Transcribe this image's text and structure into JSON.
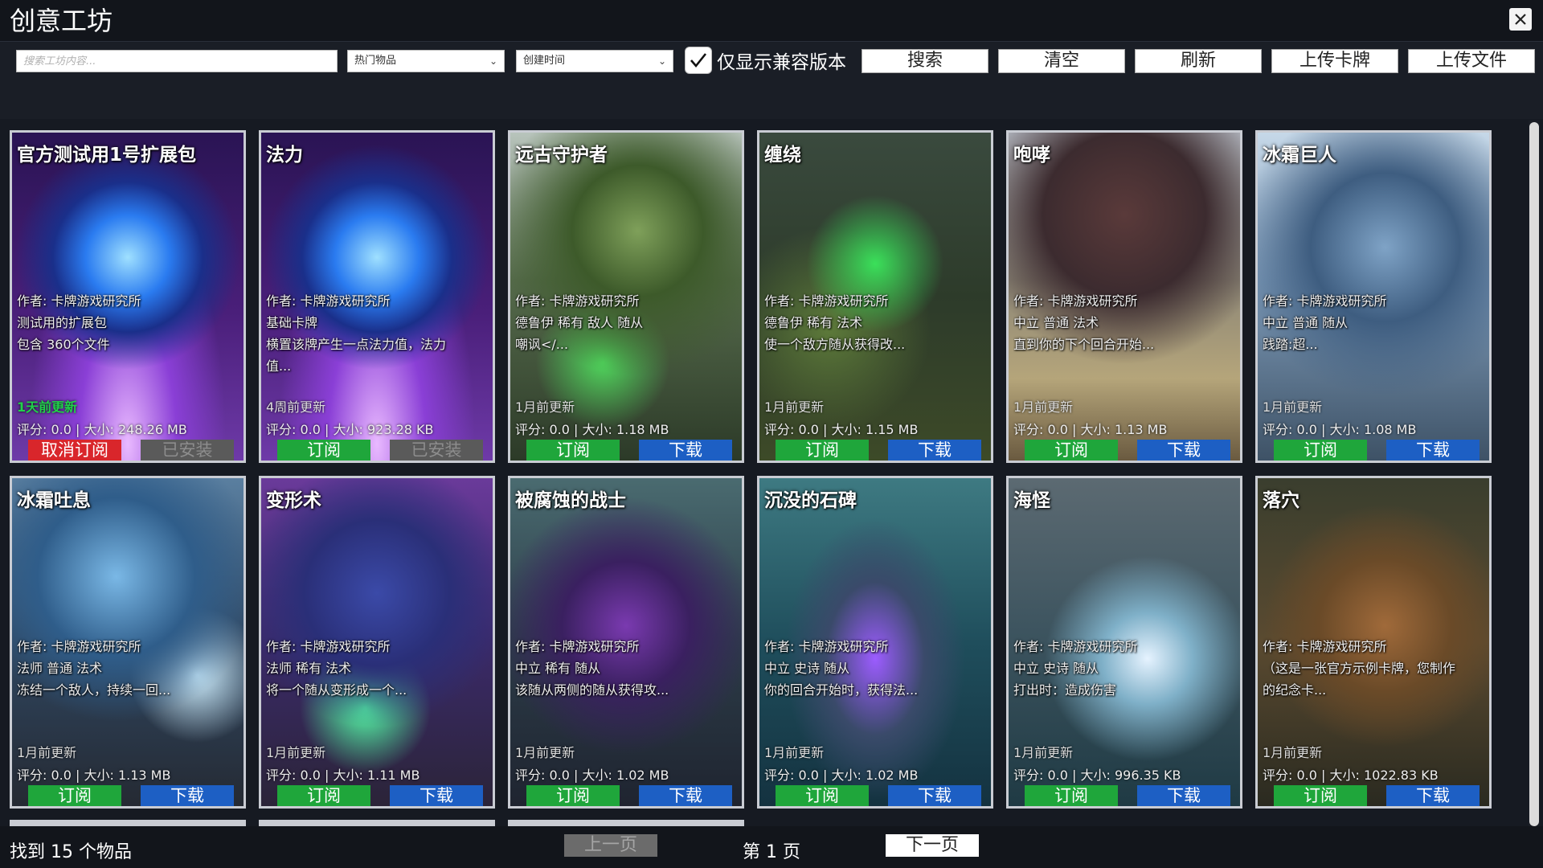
{
  "app": {
    "title": "创意工坊"
  },
  "toolbar": {
    "search_placeholder": "搜索工坊内容...",
    "sort_filter": "热门物品",
    "time_filter": "创建时间",
    "compat_label": "仅显示兼容版本",
    "compat_checked": true,
    "search_label": "搜索",
    "clear_label": "清空",
    "refresh_label": "刷新",
    "upload_card_label": "上传卡牌",
    "upload_file_label": "上传文件"
  },
  "cards": [
    {
      "title": "官方测试用1号扩展包",
      "author": "作者: 卡牌游戏研究所",
      "line2": "测试用的扩展包",
      "line3": "包含 360个文件",
      "line4": "",
      "updated": "1天前更新",
      "fresh": true,
      "stats": "评分: 0.0 | 大小: 248.26 MB",
      "btn1": "取消订阅",
      "btn1_style": "red",
      "btn2": "已安装",
      "btn2_style": "grey",
      "theme": "orb"
    },
    {
      "title": "法力",
      "author": "作者: 卡牌游戏研究所",
      "line2": "基础卡牌",
      "line3": "横置该牌产生一点法力值，法力",
      "line4": "值...",
      "updated": "4周前更新",
      "fresh": false,
      "stats": "评分: 0.0 | 大小: 923.28 KB",
      "btn1": "订阅",
      "btn1_style": "green",
      "btn2": "已安装",
      "btn2_style": "grey",
      "theme": "orb"
    },
    {
      "title": "远古守护者",
      "author": "作者: 卡牌游戏研究所",
      "line2": "德鲁伊 稀有 敌人 随从",
      "line3": "嘲讽</...",
      "line4": "",
      "updated": "1月前更新",
      "fresh": false,
      "stats": "评分: 0.0 | 大小: 1.18 MB",
      "btn1": "订阅",
      "btn1_style": "green",
      "btn2": "下载",
      "btn2_style": "blue",
      "theme": "forest"
    },
    {
      "title": "缠绕",
      "author": "作者: 卡牌游戏研究所",
      "line2": "德鲁伊 稀有 法术",
      "line3": "使一个敌方随从获得改...",
      "line4": "",
      "updated": "1月前更新",
      "fresh": false,
      "stats": "评分: 0.0 | 大小: 1.15 MB",
      "btn1": "订阅",
      "btn1_style": "green",
      "btn2": "下载",
      "btn2_style": "blue",
      "theme": "vines"
    },
    {
      "title": "咆哮",
      "author": "作者: 卡牌游戏研究所",
      "line2": "中立 普通 法术",
      "line3": "直到你的下个回合开始...",
      "line4": "",
      "updated": "1月前更新",
      "fresh": false,
      "stats": "评分: 0.0 | 大小: 1.13 MB",
      "btn1": "订阅",
      "btn1_style": "green",
      "btn2": "下载",
      "btn2_style": "blue",
      "theme": "battle"
    },
    {
      "title": "冰霜巨人",
      "author": "作者: 卡牌游戏研究所",
      "line2": "中立 普通 随从",
      "line3": "践踏:超...",
      "line4": "",
      "updated": "1月前更新",
      "fresh": false,
      "stats": "评分: 0.0 | 大小: 1.08 MB",
      "btn1": "订阅",
      "btn1_style": "green",
      "btn2": "下载",
      "btn2_style": "blue",
      "theme": "frost"
    },
    {
      "title": "冰霜吐息",
      "author": "作者: 卡牌游戏研究所",
      "line2": "法师 普通 法术",
      "line3": "冻结一个敌人，持续一回...",
      "line4": "",
      "updated": "1月前更新",
      "fresh": false,
      "stats": "评分: 0.0 | 大小: 1.13 MB",
      "btn1": "订阅",
      "btn1_style": "green",
      "btn2": "下载",
      "btn2_style": "blue",
      "theme": "dragon"
    },
    {
      "title": "变形术",
      "author": "作者: 卡牌游戏研究所",
      "line2": "法师 稀有 法术",
      "line3": "将一个随从变形成一个...",
      "line4": "",
      "updated": "1月前更新",
      "fresh": false,
      "stats": "评分: 0.0 | 大小: 1.11 MB",
      "btn1": "订阅",
      "btn1_style": "green",
      "btn2": "下载",
      "btn2_style": "blue",
      "theme": "wizard"
    },
    {
      "title": "被腐蚀的战士",
      "author": "作者: 卡牌游戏研究所",
      "line2": "中立 稀有 随从",
      "line3": "该随从两侧的随从获得攻...",
      "line4": "",
      "updated": "1月前更新",
      "fresh": false,
      "stats": "评分: 0.0 | 大小: 1.02 MB",
      "btn1": "订阅",
      "btn1_style": "green",
      "btn2": "下载",
      "btn2_style": "blue",
      "theme": "corrupt"
    },
    {
      "title": "沉没的石碑",
      "author": "作者: 卡牌游戏研究所",
      "line2": "中立 史诗 随从",
      "line3": "你的回合开始时，获得法...",
      "line4": "",
      "updated": "1月前更新",
      "fresh": false,
      "stats": "评分: 0.0 | 大小: 1.02 MB",
      "btn1": "订阅",
      "btn1_style": "green",
      "btn2": "下载",
      "btn2_style": "blue",
      "theme": "stone"
    },
    {
      "title": "海怪",
      "author": "作者: 卡牌游戏研究所",
      "line2": "中立 史诗 随从",
      "line3": "打出时：造成伤害",
      "line4": "",
      "updated": "1月前更新",
      "fresh": false,
      "stats": "评分: 0.0 | 大小: 996.35 KB",
      "btn1": "订阅",
      "btn1_style": "green",
      "btn2": "下载",
      "btn2_style": "blue",
      "theme": "sea"
    },
    {
      "title": "落穴",
      "author": "作者: 卡牌游戏研究所",
      "line2": "（这是一张官方示例卡牌，您制作",
      "line3": "的纪念卡...",
      "line4": "",
      "updated": "1月前更新",
      "fresh": false,
      "stats": "评分: 0.0 | 大小: 1022.83 KB",
      "btn1": "订阅",
      "btn1_style": "green",
      "btn2": "下载",
      "btn2_style": "blue",
      "theme": "mud"
    }
  ],
  "footer": {
    "count_text": "找到 15 个物品",
    "prev_label": "上一页",
    "page_text": "第 1 页",
    "next_label": "下一页"
  },
  "colors": {
    "subscribe": "#1fa63b",
    "download": "#1d5fc4",
    "unsubscribe": "#d9262b",
    "installed": "#5a5a5a",
    "fresh_update": "#21d24a"
  }
}
